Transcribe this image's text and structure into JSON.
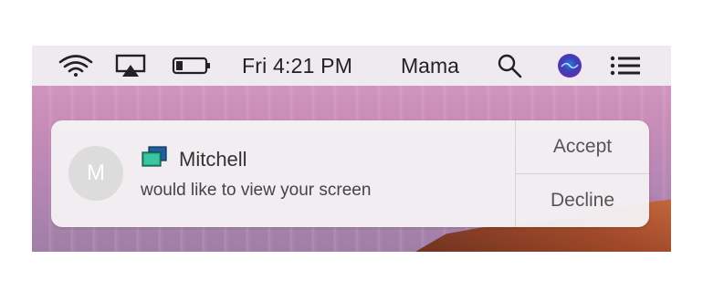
{
  "menubar": {
    "clock": "Fri 4:21 PM",
    "user_name": "Mama",
    "icons": [
      "wifi-icon",
      "airplay-icon",
      "battery-icon",
      "search-icon",
      "siri-icon",
      "notification-center-icon"
    ]
  },
  "notification": {
    "avatar_initial": "M",
    "sender": "Mitchell",
    "message": "would like to view your screen",
    "accept_label": "Accept",
    "decline_label": "Decline",
    "app_icon": "screen-sharing-icon"
  },
  "colors": {
    "wallpaper_top": "#d7a0c7",
    "wallpaper_bottom": "#9f7fa6",
    "rock": "#a24a2a",
    "menubar": "#eeecf2",
    "notification_bg": "#f4f1f4",
    "siri_purple": "#5d2fb0",
    "siri_blue": "#2b7dd9"
  }
}
